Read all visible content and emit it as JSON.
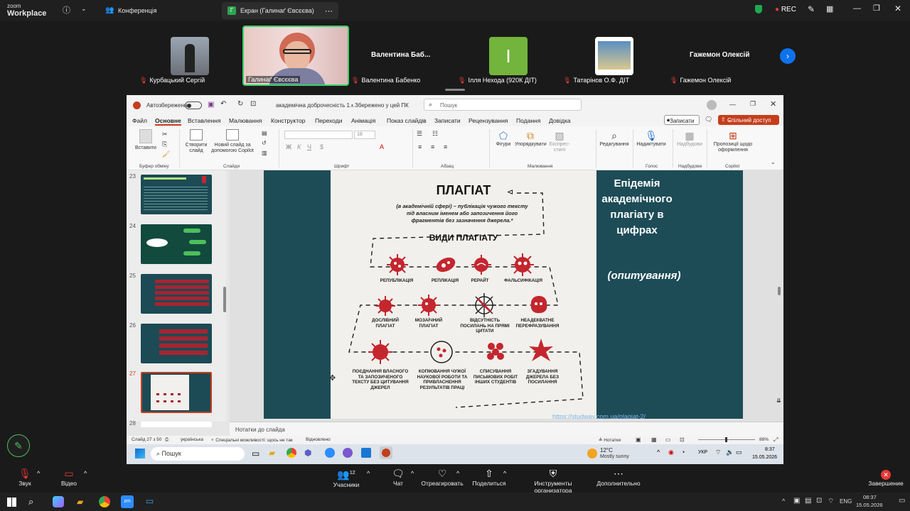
{
  "zoom": {
    "logo_small": "zoom",
    "logo_big": "Workplace",
    "tab_conference": "Конференція",
    "tab_screen": "Екран (Галинаґ Євсєєва)",
    "rec": "REC"
  },
  "participants": [
    {
      "name": "Курбацький Сергій"
    },
    {
      "name": "Галинаґ Євсєєва"
    },
    {
      "name": "Валентина Бабенко",
      "big": "Валентина  Баб..."
    },
    {
      "name": "Ілля Нехода (920К ДІТ)",
      "initial": "І"
    },
    {
      "name": "Татарінов О.Ф. ДІТ"
    },
    {
      "name": "Гажемон Олексій",
      "big": "Гажемон Олексій"
    }
  ],
  "ppt": {
    "autosave": "Автозбереження",
    "file_title": "академічна доброчесність 1...",
    "saved": "• Збережено у цей ПК",
    "search": "Пошук",
    "menu": [
      "Файл",
      "Основне",
      "Вставлення",
      "Малювання",
      "Конструктор",
      "Переходи",
      "Анімація",
      "Показ слайдів",
      "Записати",
      "Рецензування",
      "Подання",
      "Довідка"
    ],
    "record_btn": "Записати",
    "share_btn": "Спільний доступ",
    "ribbon": {
      "paste": "Вставити",
      "clipboard": "Буфер обміну",
      "new_slide": "Створити слайд",
      "copilot_slide": "Новий слайд за допомогою Copilot",
      "slides": "Слайди",
      "font_size": "18",
      "font": "Шрифт",
      "paragraph": "Абзац",
      "shapes": "Фігури",
      "arrange": "Упорядкувати",
      "quick_styles": "Експрес-стилі",
      "drawing": "Малювання",
      "editing": "Редагування",
      "dictate": "Надиктувати",
      "voice": "Голос",
      "addins": "Надбудови",
      "addins_group": "Надбудови",
      "copilot_design": "Пропозиції щодо оформлення",
      "copilot": "Copilot"
    },
    "thumb_numbers": [
      "23",
      "24",
      "25",
      "26",
      "27",
      "28"
    ],
    "notes": "Нотатки до слайда",
    "status": {
      "slide": "Слайд 27 з 50",
      "lang": "українська",
      "accessibility": "Спеціальні можливості: щось не так",
      "restored": "Відновлено",
      "notes": "Нотатки",
      "zoom": "88%"
    },
    "slide": {
      "title": "ПЛАГІАТ",
      "definition": "(в академічній сфері) – публікація чужого тексту під власним іменем або запозичення його фрагментів без зазначення джерела.*",
      "types_title": "ВИДИ ПЛАГІАТУ",
      "types": [
        "РЕПУБЛІКАЦІЯ",
        "РЕПЛІКАЦІЯ",
        "РЕРАЙТ",
        "ФАЛЬСИФІКАЦІЯ",
        "ДОСЛІВНИЙ ПЛАГІАТ",
        "МОЗАЇЧНИЙ ПЛАГІАТ",
        "ВІДСУТНІСТЬ ПОСИЛАНЬ НА ПРЯМІ ЦИТАТИ",
        "НЕАДЕКВАТНЕ ПЕРЕФРАЗУВАННЯ",
        "ПОЄДНАННЯ ВЛАСНОГО ТА ЗАПОЗИЧЕНОГО ТЕКСТУ БЕЗ ЦИТУВАННЯ ДЖЕРЕЛ",
        "КОПІЮВАННЯ ЧУЖОЇ НАУКОВОЇ РОБОТИ ТА ПРИВЛАСНЕННЯ РЕЗУЛЬТАТІВ ПРАЦІ",
        "СПИСУВАННЯ ПИСЬМОВИХ РОБІТ ІНШИХ СТУДЕНТІВ",
        "ЗГАДУВАННЯ ДЖЕРЕЛА БЕЗ ПОСИЛАННЯ"
      ],
      "right_title": "Епідемія академічного плагіату в цифрах",
      "right_sub": "(опитування)",
      "link": "https://studway.com.ua/plagiat-2/"
    }
  },
  "remote_taskbar": {
    "search": "Пошук",
    "weather_temp": "12°C",
    "weather_desc": "Mostly sunny",
    "lang": "УКР",
    "time": "8:37",
    "date": "15.05.2026"
  },
  "controls": {
    "sound": "Звук",
    "video": "Відео",
    "participants": "Учасники",
    "participants_count": "12",
    "chat": "Чат",
    "react": "Отреагировать",
    "share": "Поделиться",
    "host_tools": "Инструменты организатора",
    "more": "Дополнительно",
    "end": "Завершение"
  },
  "win_taskbar": {
    "lang": "ENG",
    "time": "08:37",
    "date": "15.05.2026"
  },
  "colors": {
    "accent_red": "#c4262e",
    "slide_teal": "#1d4c57",
    "zoom_bg": "#1a1a1a",
    "ppt_orange": "#c43e1c"
  }
}
